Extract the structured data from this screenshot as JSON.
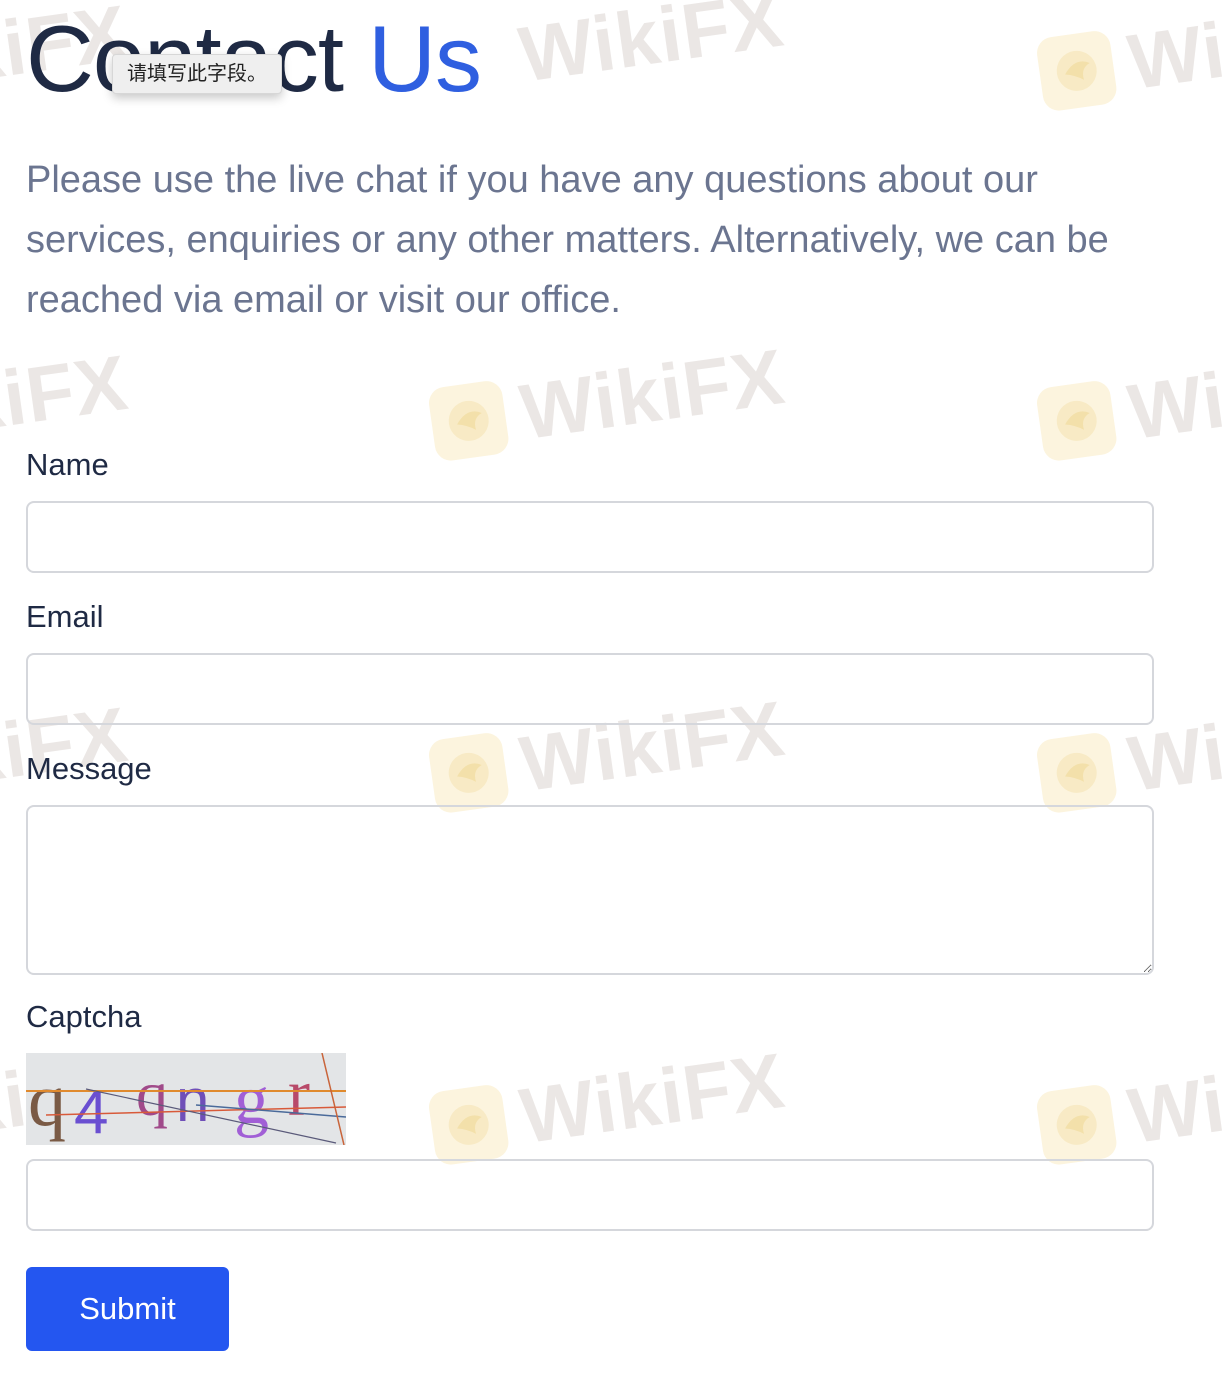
{
  "header": {
    "title_main": "Contact",
    "title_accent": "Us",
    "validation_tooltip": "请填写此字段。"
  },
  "intro": {
    "text": "Please use the live chat if you have any questions about our services, enquiries or any other matters. Alternatively, we can be reached via email or visit our office."
  },
  "form": {
    "name_label": "Name",
    "name_value": "",
    "email_label": "Email",
    "email_value": "",
    "message_label": "Message",
    "message_value": "",
    "captcha_label": "Captcha",
    "captcha_text": "q4qngr",
    "captcha_value": "",
    "submit_label": "Submit"
  },
  "watermark": {
    "text": "WikiFX",
    "partial_text_right": "Wi",
    "partial_text_left": "kiFX"
  },
  "colors": {
    "accent": "#2f5fe0",
    "button": "#2456f0",
    "heading": "#1f2a44",
    "body_text": "#6b7590"
  }
}
